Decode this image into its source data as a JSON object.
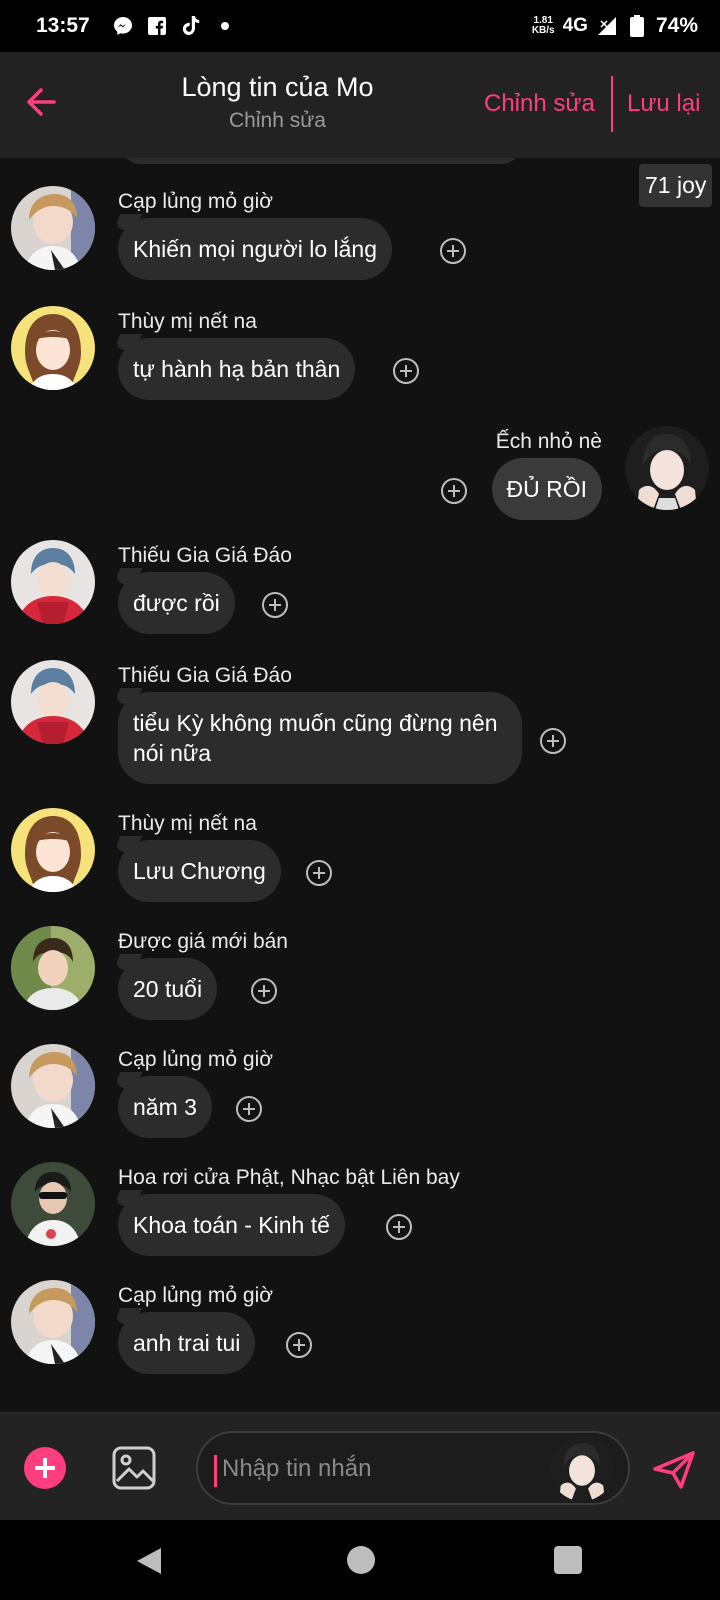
{
  "status_bar": {
    "time": "13:57",
    "speed_value": "1.81",
    "speed_unit": "KB/s",
    "network": "4G",
    "battery": "74%",
    "icons": [
      "messenger-icon",
      "facebook-icon",
      "tiktok-icon",
      "dot-icon",
      "signal-icon",
      "battery-icon"
    ]
  },
  "header": {
    "title": "Lòng tin của Mo",
    "subtitle": "Chỉnh sửa",
    "edit_label": "Chỉnh sửa",
    "save_label": "Lưu lại",
    "accent_color": "#ff3d7f"
  },
  "chat": {
    "side_badge": "71 joy",
    "messages": [
      {
        "side": "left",
        "sender": "Cạp lủng mỏ giờ",
        "text": "Khiến mọi người lo lắng",
        "avatar": "avatar-blonde-boy"
      },
      {
        "side": "left",
        "sender": "Thùy mị nết na",
        "text": "tự hành hạ bản thân",
        "avatar": "avatar-girl-yellow"
      },
      {
        "side": "right",
        "sender": "Ếch nhỏ nè",
        "text": "ĐỦ RỒI",
        "avatar": "avatar-boy-hands"
      },
      {
        "side": "left",
        "sender": "Thiếu Gia Giá Đáo",
        "text": "được rồi",
        "avatar": "avatar-boy-red"
      },
      {
        "side": "left",
        "sender": "Thiếu Gia Giá Đáo",
        "text": "tiểu Kỳ không muốn cũng đừng nên nói nữa",
        "avatar": "avatar-boy-red"
      },
      {
        "side": "left",
        "sender": "Thùy mị nết na",
        "text": "Lưu Chương",
        "avatar": "avatar-girl-yellow"
      },
      {
        "side": "left",
        "sender": "Được giá mới bán",
        "text": "20 tuổi",
        "avatar": "avatar-boy-green"
      },
      {
        "side": "left",
        "sender": "Cạp lủng mỏ giờ",
        "text": "năm 3",
        "avatar": "avatar-blonde-boy"
      },
      {
        "side": "left",
        "sender": "Hoa rơi cửa Phật, Nhạc bật Liên bay",
        "text": "Khoa toán - Kinh tế",
        "avatar": "avatar-boy-glasses"
      },
      {
        "side": "left",
        "sender": "Cạp lủng mỏ giờ",
        "text": "anh trai tui",
        "avatar": "avatar-blonde-boy"
      }
    ]
  },
  "input": {
    "placeholder": "Nhập tin nhắn"
  }
}
